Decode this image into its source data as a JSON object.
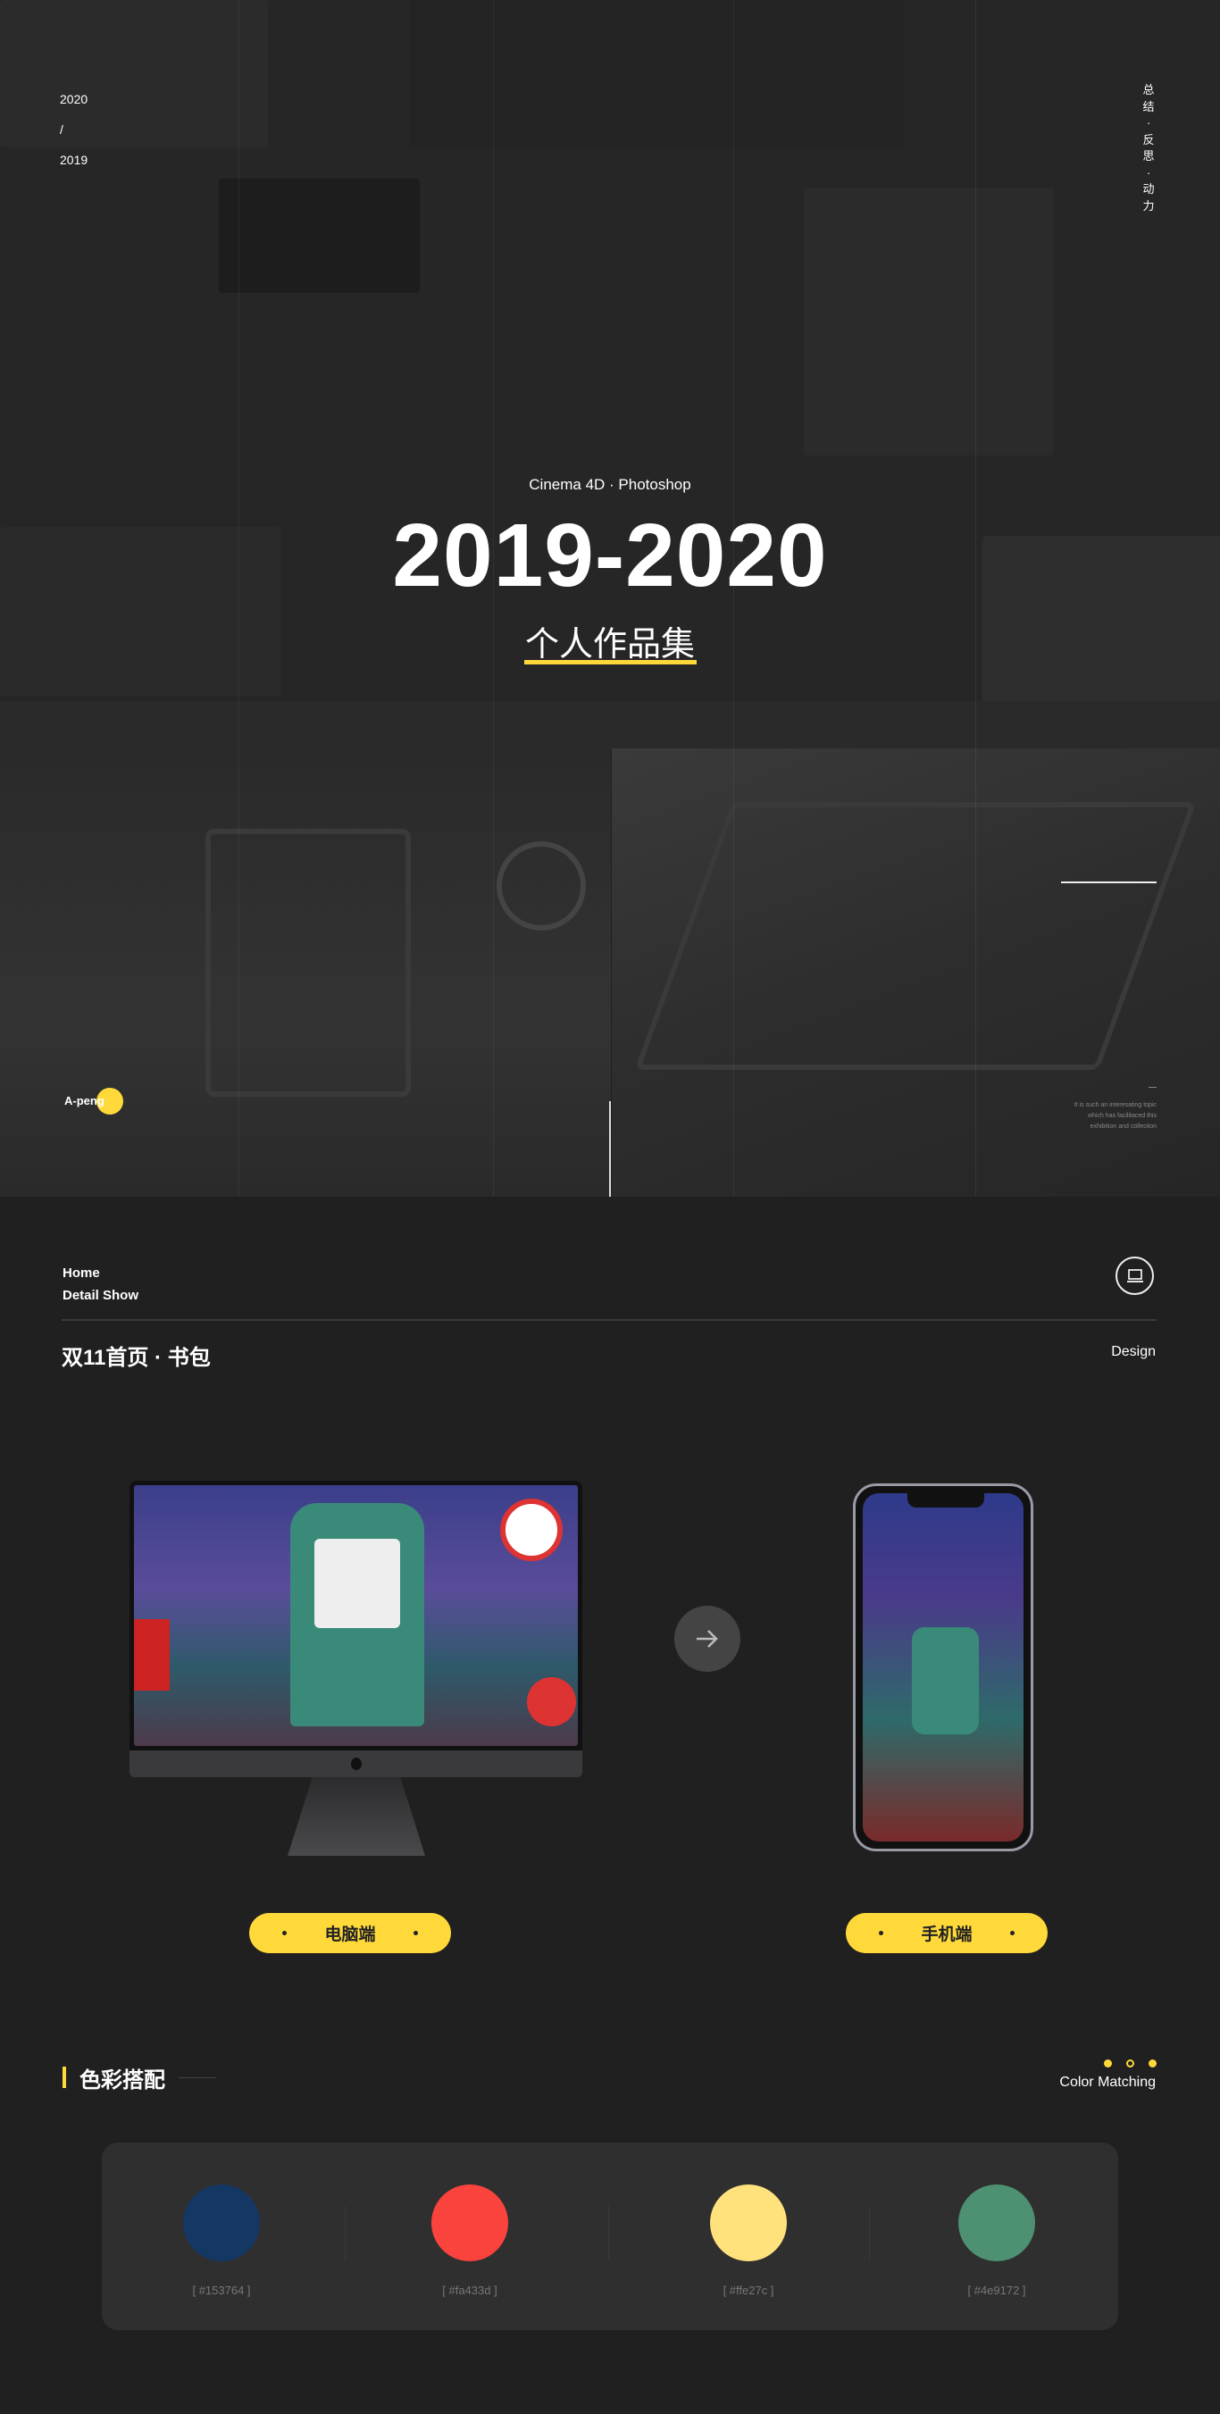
{
  "hero": {
    "year_top": "2020",
    "year_sep": "/",
    "year_bottom": "2019",
    "side_text": [
      "总",
      "结",
      "·",
      "反",
      "思",
      "·",
      "动",
      "力"
    ],
    "tools": "Cinema 4D · Photoshop",
    "title": "2019-2020",
    "subtitle": "个人作品集"
  },
  "band": {
    "author": "A-peng",
    "caption": [
      "It is such an interesating topic",
      "which has facilitaced this",
      "exhibition and collection"
    ]
  },
  "detail": {
    "nav_home": "Home",
    "nav_detail": "Detail Show",
    "icon": "laptop-icon",
    "title": "双11首页 · 书包",
    "tag": "Design",
    "desktop_label": "电脑端",
    "mobile_label": "手机端",
    "arrow_icon": "arrow-right-icon"
  },
  "colors": {
    "title": "色彩搭配",
    "subtitle": "Color Matching",
    "accent": "#ffd93a",
    "swatches": [
      {
        "hex": "#153764",
        "label": "[ #153764 ]"
      },
      {
        "hex": "#fa433d",
        "label": "[ #fa433d ]"
      },
      {
        "hex": "#ffe27c",
        "label": "[ #ffe27c ]"
      },
      {
        "hex": "#4e9172",
        "label": "[ #4e9172 ]"
      }
    ]
  }
}
